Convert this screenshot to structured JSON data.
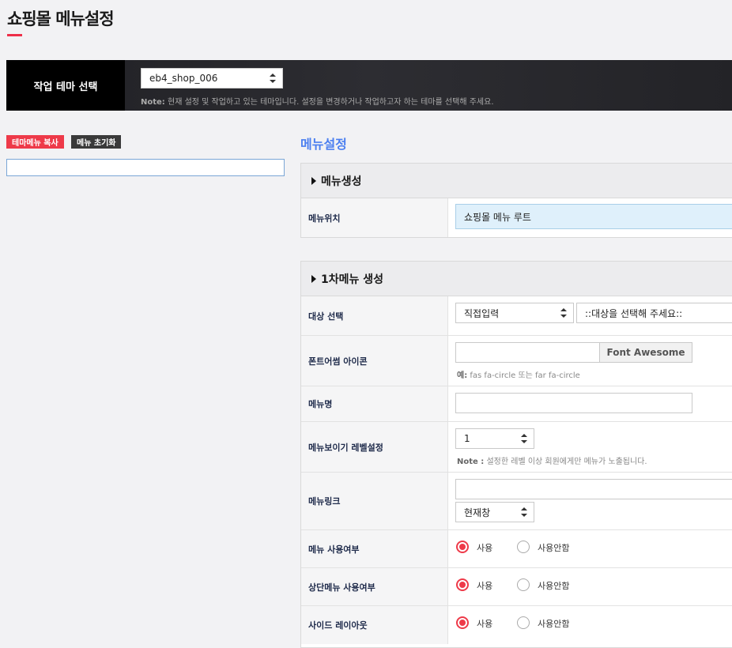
{
  "page": {
    "title": "쇼핑몰 메뉴설정"
  },
  "theme_bar": {
    "label": "작업 테마 선택",
    "selected": "eb4_shop_006",
    "note_bold": "Note:",
    "note_text": " 현재 설정 및 작업하고 있는 테마입니다. 설정을 변경하거나 작업하고자 하는 테마를 선택해 주세요."
  },
  "left": {
    "copy_button": "테마메뉴 복사",
    "reset_button": "메뉴 초기화",
    "input_value": ""
  },
  "main": {
    "section_title": "메뉴설정",
    "menu_create": {
      "title": "메뉴생성",
      "position_label": "메뉴위치",
      "position_value": "쇼핑몰 메뉴 루트"
    },
    "first_menu": {
      "title": "1차메뉴 생성",
      "target": {
        "label": "대상 선택",
        "type_value": "직접입력",
        "target_value": "::대상을 선택해 주세요::"
      },
      "icon": {
        "label": "폰트어썸 아이콘",
        "value": "",
        "button": "Font Awesome",
        "hint_bold": "예:",
        "hint_text": " fas fa-circle 또는 far fa-circle"
      },
      "name": {
        "label": "메뉴명",
        "value": ""
      },
      "level": {
        "label": "메뉴보이기 레벨설정",
        "value": "1",
        "hint_bold": "Note :",
        "hint_text": " 설정한 레벨 이상 회원에게만 메뉴가 노출됩니다."
      },
      "link": {
        "label": "메뉴링크",
        "value": "",
        "target_value": "현재창"
      },
      "use": {
        "label": "메뉴 사용여부",
        "opt_on": "사용",
        "opt_off": "사용안함"
      },
      "top_use": {
        "label": "상단메뉴 사용여부",
        "opt_on": "사용",
        "opt_off": "사용안함"
      },
      "side": {
        "label": "사이드 레이아웃",
        "opt_on": "사용",
        "opt_off": "사용안함"
      }
    }
  }
}
